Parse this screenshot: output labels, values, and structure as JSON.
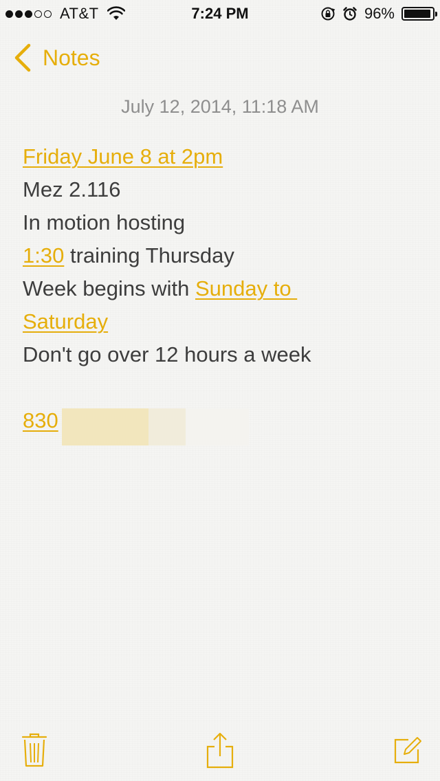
{
  "status_bar": {
    "signal_bars": 3,
    "signal_total": 5,
    "carrier": "AT&T",
    "time": "7:24 PM",
    "battery_percent": "96%",
    "battery_level": 0.96,
    "icons": [
      "wifi-icon",
      "rotation-lock-icon",
      "alarm-icon",
      "battery-icon"
    ]
  },
  "nav": {
    "back_label": "Notes",
    "back_icon": "chevron-left-icon"
  },
  "note": {
    "date": "July 12, 2014, 11:18 AM",
    "lines": {
      "l1_link": "Friday June 8 at 2pm",
      "l2": "Mez 2.116",
      "l3": "In motion hosting",
      "l4_link": "1:30",
      "l4_rest": " training Thursday",
      "l5_text": "Week begins with ",
      "l5_link": "Sunday to ",
      "l6_link": "Saturday",
      "l7": "Don't go over 12 hours a week",
      "l9_link": "830"
    }
  },
  "toolbar": {
    "trash_icon": "trash-icon",
    "share_icon": "share-icon",
    "compose_icon": "compose-icon"
  },
  "colors": {
    "accent": "#e6ae0b",
    "text": "#3d3d3d",
    "date": "#8e8e8e",
    "background": "#f5f5f3"
  }
}
